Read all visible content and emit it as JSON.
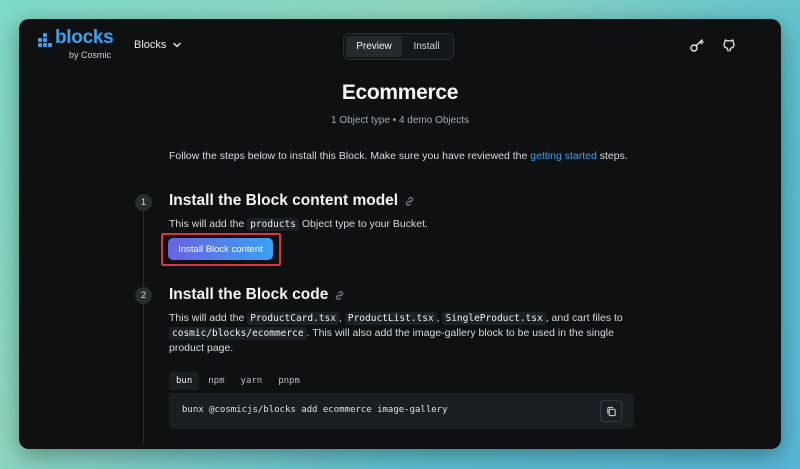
{
  "header": {
    "logo_text": "blocks",
    "logo_sub": "by Cosmic",
    "menu_label": "Blocks",
    "tabs": [
      {
        "label": "Preview",
        "active": true
      },
      {
        "label": "Install",
        "active": false
      }
    ],
    "icons": [
      "key-icon",
      "github-icon"
    ]
  },
  "page": {
    "title": "Ecommerce",
    "subtitle": "1 Object type • 4 demo Objects",
    "intro_prefix": "Follow the steps below to install this Block. Make sure you have reviewed the ",
    "intro_link": "getting started",
    "intro_suffix": " steps."
  },
  "steps": [
    {
      "number": "1",
      "title": "Install the Block content model",
      "desc_prefix": "This will add the ",
      "desc_code": "products",
      "desc_suffix": " Object type to your Bucket.",
      "button_label": "Install Block content"
    },
    {
      "number": "2",
      "title": "Install the Block code",
      "line1_prefix": "This will add the ",
      "code1": "ProductCard.tsx",
      "sep1": ", ",
      "code2": "ProductList.tsx",
      "sep2": ", ",
      "code3": "SingleProduct.tsx",
      "line1_suffix": ", and cart files to",
      "code4": "cosmic/blocks/ecommerce",
      "line2_suffix": ". This will also add the image-gallery block to be used in the single",
      "line3": "product page.",
      "package_tabs": [
        {
          "label": "bun",
          "active": true
        },
        {
          "label": "npm",
          "active": false
        },
        {
          "label": "yarn",
          "active": false
        },
        {
          "label": "pnpm",
          "active": false
        }
      ],
      "command": "bunx @cosmicjs/blocks add ecommerce image-gallery"
    }
  ],
  "colors": {
    "accent": "#3aa1f2",
    "highlight": "#d9343f",
    "button_gradient_start": "#6b62e0",
    "button_gradient_end": "#3aa1f2"
  }
}
